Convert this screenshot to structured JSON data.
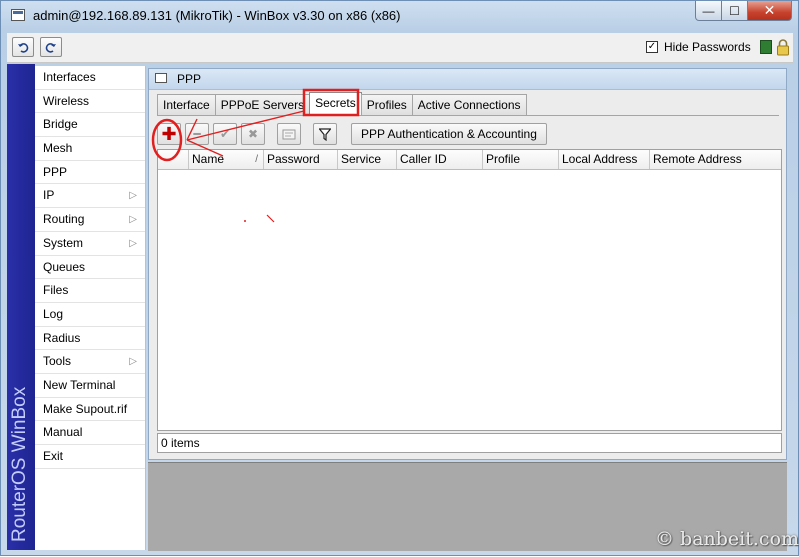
{
  "window": {
    "title": "admin@192.168.89.131 (MikroTik) - WinBox v3.30 on x86 (x86)",
    "controls": {
      "minimize": "—",
      "maximize": "☐",
      "close": "✕"
    }
  },
  "toolbar": {
    "undo_icon": "undo-icon",
    "redo_icon": "redo-icon",
    "hide_passwords_label": "Hide Passwords",
    "hide_passwords_checked": true
  },
  "sidebar": {
    "brand": "RouterOS WinBox",
    "items": [
      {
        "label": "Interfaces",
        "has_submenu": false
      },
      {
        "label": "Wireless",
        "has_submenu": false
      },
      {
        "label": "Bridge",
        "has_submenu": false
      },
      {
        "label": "Mesh",
        "has_submenu": false
      },
      {
        "label": "PPP",
        "has_submenu": false
      },
      {
        "label": "IP",
        "has_submenu": true
      },
      {
        "label": "Routing",
        "has_submenu": true
      },
      {
        "label": "System",
        "has_submenu": true
      },
      {
        "label": "Queues",
        "has_submenu": false
      },
      {
        "label": "Files",
        "has_submenu": false
      },
      {
        "label": "Log",
        "has_submenu": false
      },
      {
        "label": "Radius",
        "has_submenu": false
      },
      {
        "label": "Tools",
        "has_submenu": true
      },
      {
        "label": "New Terminal",
        "has_submenu": false
      },
      {
        "label": "Make Supout.rif",
        "has_submenu": false
      },
      {
        "label": "Manual",
        "has_submenu": false
      },
      {
        "label": "Exit",
        "has_submenu": false
      }
    ]
  },
  "ppp": {
    "title": "PPP",
    "tabs": [
      "Interface",
      "PPPoE Servers",
      "Secrets",
      "Profiles",
      "Active Connections"
    ],
    "active_tab": "Secrets",
    "auth_button": "PPP Authentication & Accounting",
    "columns": [
      "Name",
      "Password",
      "Service",
      "Caller ID",
      "Profile",
      "Local Address",
      "Remote Address"
    ],
    "rows": [],
    "status": "0 items"
  },
  "annotation_color": "#e02020",
  "watermark": "© banbeit.com"
}
